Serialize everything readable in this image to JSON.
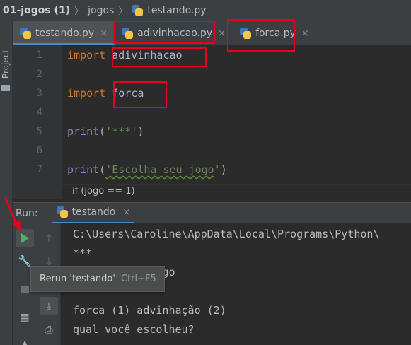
{
  "breadcrumb": {
    "project": "01-jogos (1)",
    "folder": "jogos",
    "file": "testando.py"
  },
  "left_strip": {
    "label": "Project"
  },
  "tabs": [
    {
      "label": "testando.py",
      "active": true
    },
    {
      "label": "adivinhacao.py",
      "active": false
    },
    {
      "label": "forca.py",
      "active": false
    }
  ],
  "tab_close_glyph": "×",
  "code": {
    "line_numbers": [
      "1",
      "2",
      "3",
      "4",
      "5",
      "6",
      "7"
    ],
    "line1_kw": "import",
    "line1_mod": "adivinhacao",
    "line3_kw": "import",
    "line3_mod": "forca",
    "line5_fn": "print",
    "line5_open": "(",
    "line5_str": "'***'",
    "line5_close": ")",
    "line7_fn": "print",
    "line7_open": "(",
    "line7_str_a": "'Escolha seu ",
    "line7_str_b": "jogo",
    "line7_str_c": "'",
    "line7_close": ")"
  },
  "hint": "if (jogo == 1)",
  "run_panel": {
    "title": "Run:",
    "tab_label": "testando"
  },
  "console": [
    "C:\\Users\\Caroline\\AppData\\Local\\Programs\\Python\\",
    "***",
    "             ogo",
    "***",
    "forca (1) advinhação (2)",
    "qual você escolheu?"
  ],
  "tooltip": {
    "text": "Rerun 'testando'",
    "shortcut": "Ctrl+F5"
  },
  "colors": {
    "annotation": "#e8001c",
    "keyword": "#cc7832",
    "string": "#6a8759",
    "builtin": "#8888c6",
    "run_green": "#59a869"
  },
  "icons": [
    "python-file-icon",
    "play-icon",
    "wrench-icon",
    "stop-icon",
    "arrow-up-icon",
    "arrow-down-icon",
    "soft-wrap-icon",
    "print-icon",
    "layout-icon",
    "red-arrow-icon"
  ]
}
